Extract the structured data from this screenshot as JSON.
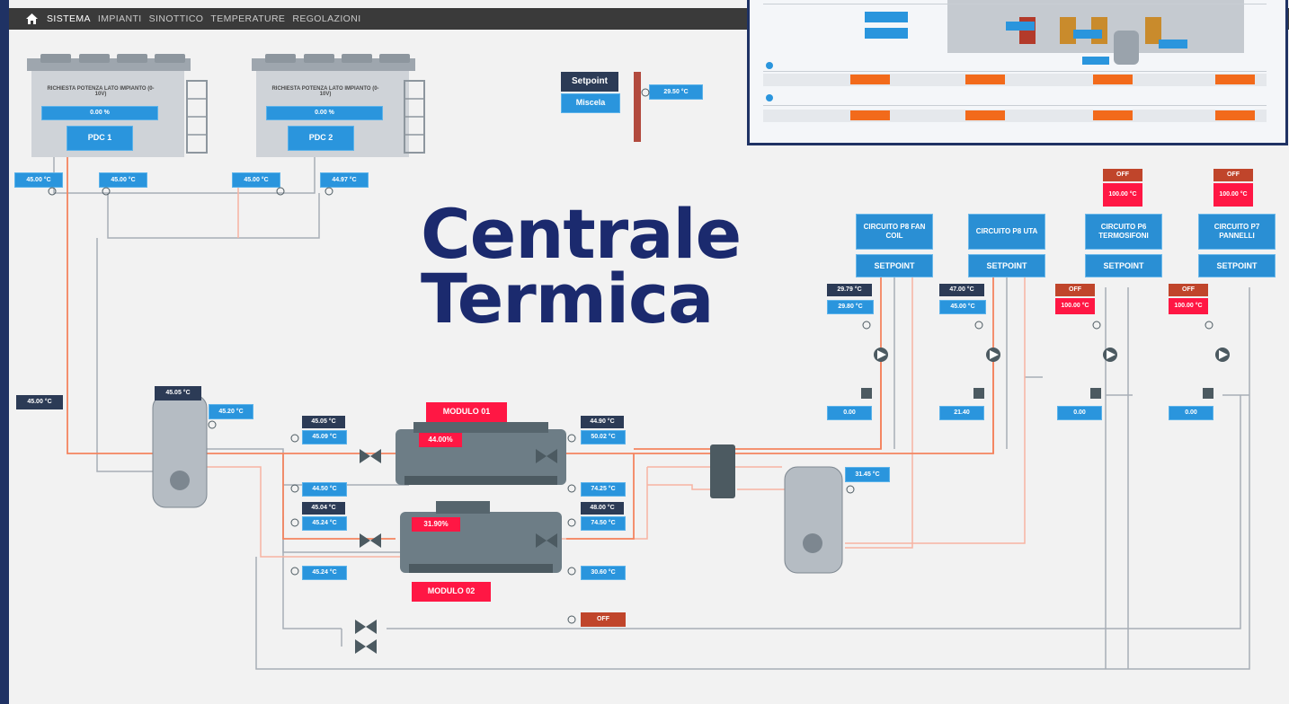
{
  "topbar": {
    "nav": [
      "SISTEMA",
      "IMPIANTI",
      "SINOTTICO",
      "TEMPERATURE",
      "REGOLAZIONI"
    ],
    "active": "SISTEMA"
  },
  "title": {
    "line1": "Centrale",
    "line2": "Termica"
  },
  "pdc": [
    {
      "heading": "RICHIESTA POTENZA LATO IMPIANTO (0-10V)",
      "value": "0.00 %",
      "label": "PDC 1"
    },
    {
      "heading": "RICHIESTA POTENZA LATO IMPIANTO (0-10V)",
      "value": "0.00 %",
      "label": "PDC 2"
    }
  ],
  "pdc_temps": [
    "45.00 °C",
    "45.00 °C",
    "45.00 °C",
    "44.97 °C"
  ],
  "setpoint_box": {
    "label": "Setpoint",
    "button": "Miscela",
    "value": "29.50 °C"
  },
  "left_temp": "45.00 °C",
  "tank1": {
    "top_temp": "45.05 °C",
    "side_temp": "45.20 °C"
  },
  "tank2": {
    "temp": "31.45 °C"
  },
  "moduli": [
    {
      "label": "MODULO 01",
      "pct": "44.00%"
    },
    {
      "label": "MODULO 02",
      "pct": "31.90%"
    }
  ],
  "mod_in_temps": [
    [
      "45.05 °C",
      "45.09 °C"
    ],
    [
      "44.50 °C"
    ],
    [
      "45.04 °C",
      "45.24 °C"
    ],
    [
      "45.24 °C"
    ]
  ],
  "mod_out_temps": [
    [
      "44.90 °C",
      "50.02 °C"
    ],
    [
      "74.25 °C"
    ],
    [
      "48.00 °C",
      "74.50 °C"
    ],
    [
      "30.60 °C"
    ]
  ],
  "bypass": {
    "status": "OFF"
  },
  "circuits": [
    {
      "name": "CIRCUITO P8 FAN COIL",
      "setpoint": "SETPOINT",
      "t1": "29.79 °C",
      "t2": "29.80 °C",
      "flow": "0.00",
      "off": "",
      "off_val": ""
    },
    {
      "name": "CIRCUITO P8 UTA",
      "setpoint": "SETPOINT",
      "t1": "47.00 °C",
      "t2": "45.00 °C",
      "flow": "21.40",
      "off": "",
      "off_val": ""
    },
    {
      "name": "CIRCUITO P6 TERMOSIFONI",
      "setpoint": "SETPOINT",
      "t1": "OFF",
      "t2": "100.00 °C",
      "flow": "0.00",
      "off": "OFF",
      "off_val": "100.00 °C"
    },
    {
      "name": "CIRCUITO P7 PANNELLI",
      "setpoint": "SETPOINT",
      "t1": "OFF",
      "t2": "100.00 °C",
      "flow": "0.00",
      "off": "OFF",
      "off_val": "100.00 °C"
    }
  ],
  "colors": {
    "pipe_hot": "#f4845f",
    "pipe_warm": "#f8b3a1",
    "pipe_cold": "#a8aeb6",
    "blue_tag": "#2a95dd",
    "red_tag": "#ff1744",
    "dark_tag": "#2c3b56",
    "orange_tag": "#c0452b",
    "title": "#1b2a6e",
    "frame": "#1f3264"
  },
  "icons": [
    "home-icon",
    "thermometer-icon",
    "pump-icon",
    "valve-icon"
  ]
}
